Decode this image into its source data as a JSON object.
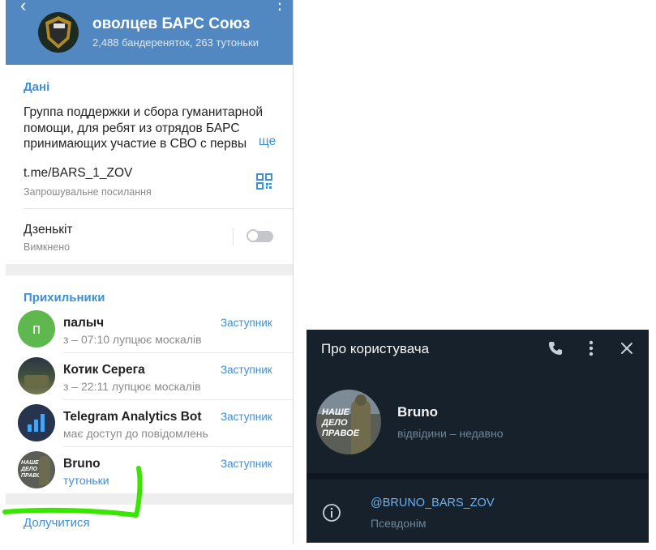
{
  "left_panel": {
    "header": {
      "title": "оволцев БАРС   Союз",
      "subtitle": "2,488 бандереняток, 263 тутоньки"
    },
    "info": {
      "section_title": "Дані",
      "description": "Группа поддержки и сбора гуманитарной помощи,  для ребят из отрядов БАРС принимающих участие в СВО с первы",
      "more_label": "ще",
      "link": "t.me/BARS_1_ZOV",
      "link_caption": "Запрошувальне посилання",
      "zen_label": "Дзенькіт",
      "zen_state": "Вимкнено"
    },
    "members_title": "Прихильники",
    "members": [
      {
        "avatar_letter": "п",
        "name": "палыч",
        "status": "з – 07:10 лупцює москалів",
        "role": "Заступник",
        "avatar_color": "#5fb84d"
      },
      {
        "avatar_letter": "",
        "name": "Котик Серега",
        "status": "з – 22:11 лупцює москалів",
        "role": "Заступник",
        "avatar_color": "#3a4a35"
      },
      {
        "avatar_letter": "",
        "name": "Telegram Analytics Bot",
        "status": "має доступ до повідомлень",
        "role": "Заступник",
        "avatar_color": "#2b3a52"
      },
      {
        "avatar_letter": "",
        "name": "Bruno",
        "status": "тутоньки",
        "role": "Заступник",
        "avatar_color": "#5b5e57"
      }
    ],
    "join_label": "Долучитися",
    "highlight_color": "#39e600"
  },
  "user_card": {
    "title": "Про користувача",
    "name": "Bruno",
    "last_seen": "відвідини – недавно",
    "username": "@BRUNO_BARS_ZOV",
    "username_label": "Псевдонім",
    "avatar_text": [
      "НАШЕ",
      "ДЕЛО",
      "ПРАВОЕ"
    ],
    "icons": [
      "phone-icon",
      "more-vertical-icon",
      "close-icon",
      "info-icon"
    ]
  }
}
